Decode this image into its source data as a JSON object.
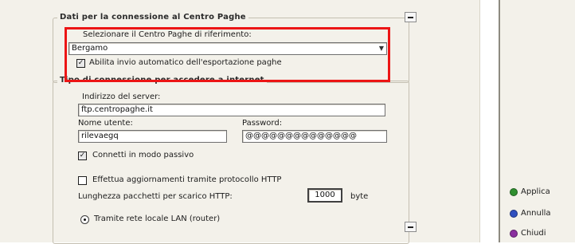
{
  "section_centro_paghe": {
    "title": "Dati per la connessione al Centro Paghe",
    "select_label": "Selezionare il Centro Paghe di riferimento:",
    "selected_value": "Bergamo",
    "auto_export_label": "Abilita invio automatico dell'esportazione paghe",
    "auto_export_checked": true
  },
  "section_connessione": {
    "title": "Tipo di connessione per accedere a internet",
    "server_label": "Indirizzo del server:",
    "server_value": "ftp.centropaghe.it",
    "username_label": "Nome utente:",
    "username_value": "rilevaegq",
    "password_label": "Password:",
    "password_value": "@@@@@@@@@@@@@@",
    "passive_label": "Connetti in modo passivo",
    "passive_checked": true,
    "http_update_label": "Effettua aggiornamenti tramite protocollo HTTP",
    "http_update_checked": false,
    "packet_label": "Lunghezza pacchetti per scarico HTTP:",
    "packet_value": "1000",
    "packet_unit": "byte",
    "lan_label": "Tramite rete locale LAN (router)",
    "lan_selected": true
  },
  "actions": {
    "apply": {
      "label": "Applica",
      "color": "#2f8f2f"
    },
    "cancel": {
      "label": "Annulla",
      "color": "#2f4fbf"
    },
    "close": {
      "label": "Chiudi",
      "color": "#8a2f9f"
    }
  },
  "colors": {
    "highlight": "#ec1515",
    "panel_bg": "#f3f1ea"
  },
  "icons": {
    "scroll_up": "scroll-up-icon",
    "scroll_down": "scroll-down-icon",
    "dropdown": "chevron-down-icon"
  }
}
